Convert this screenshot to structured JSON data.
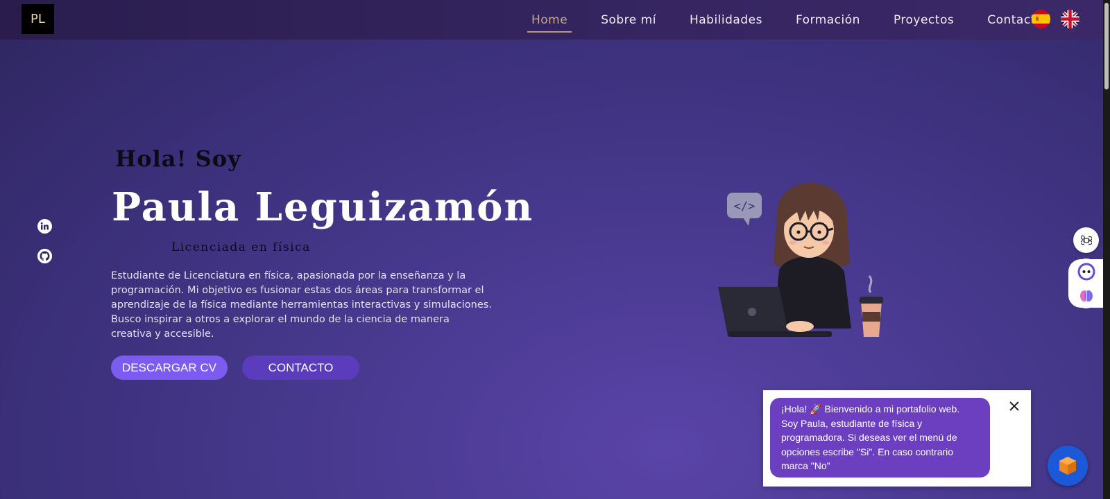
{
  "header": {
    "logo_text": "PL",
    "nav": [
      "Home",
      "Sobre mí",
      "Habilidades",
      "Formación",
      "Proyectos",
      "Contacto"
    ],
    "active_nav": "Home",
    "languages": [
      "es-flag-icon",
      "uk-flag-icon"
    ]
  },
  "social": {
    "icons": [
      "linkedin-icon",
      "github-icon"
    ]
  },
  "hero": {
    "greeting": "Hola! Soy",
    "name": "Paula Leguizamón",
    "role": "Licenciada en física",
    "description": "Estudiante de Licenciatura en física, apasionada por la enseñanza y la programación. Mi objetivo es fusionar estas dos áreas para transformar el aprendizaje de la física mediante herramientas interactivas y simulaciones. Busco inspirar a otros a explorar el mundo de la ciencia de manera creativa y accesible.",
    "download_cv_label": "DESCARGAR CV",
    "contact_label": "CONTACTO"
  },
  "chat": {
    "message": "¡Hola! 🚀 Bienvenido a mi portafolio web. Soy Paula, estudiante de física y programadora. Si deseas ver el menú de opciones escribe \"Si\". En caso contrario marca \"No\"",
    "close_icon": "close-icon",
    "fab_icon": "cube-icon"
  },
  "colors": {
    "accent": "#7c5cf0",
    "secondary_button": "#5a3cbc",
    "active_nav": "#c9a58c",
    "chat_bubble": "#6b3fc0",
    "chat_fab": "#1b59d8"
  }
}
